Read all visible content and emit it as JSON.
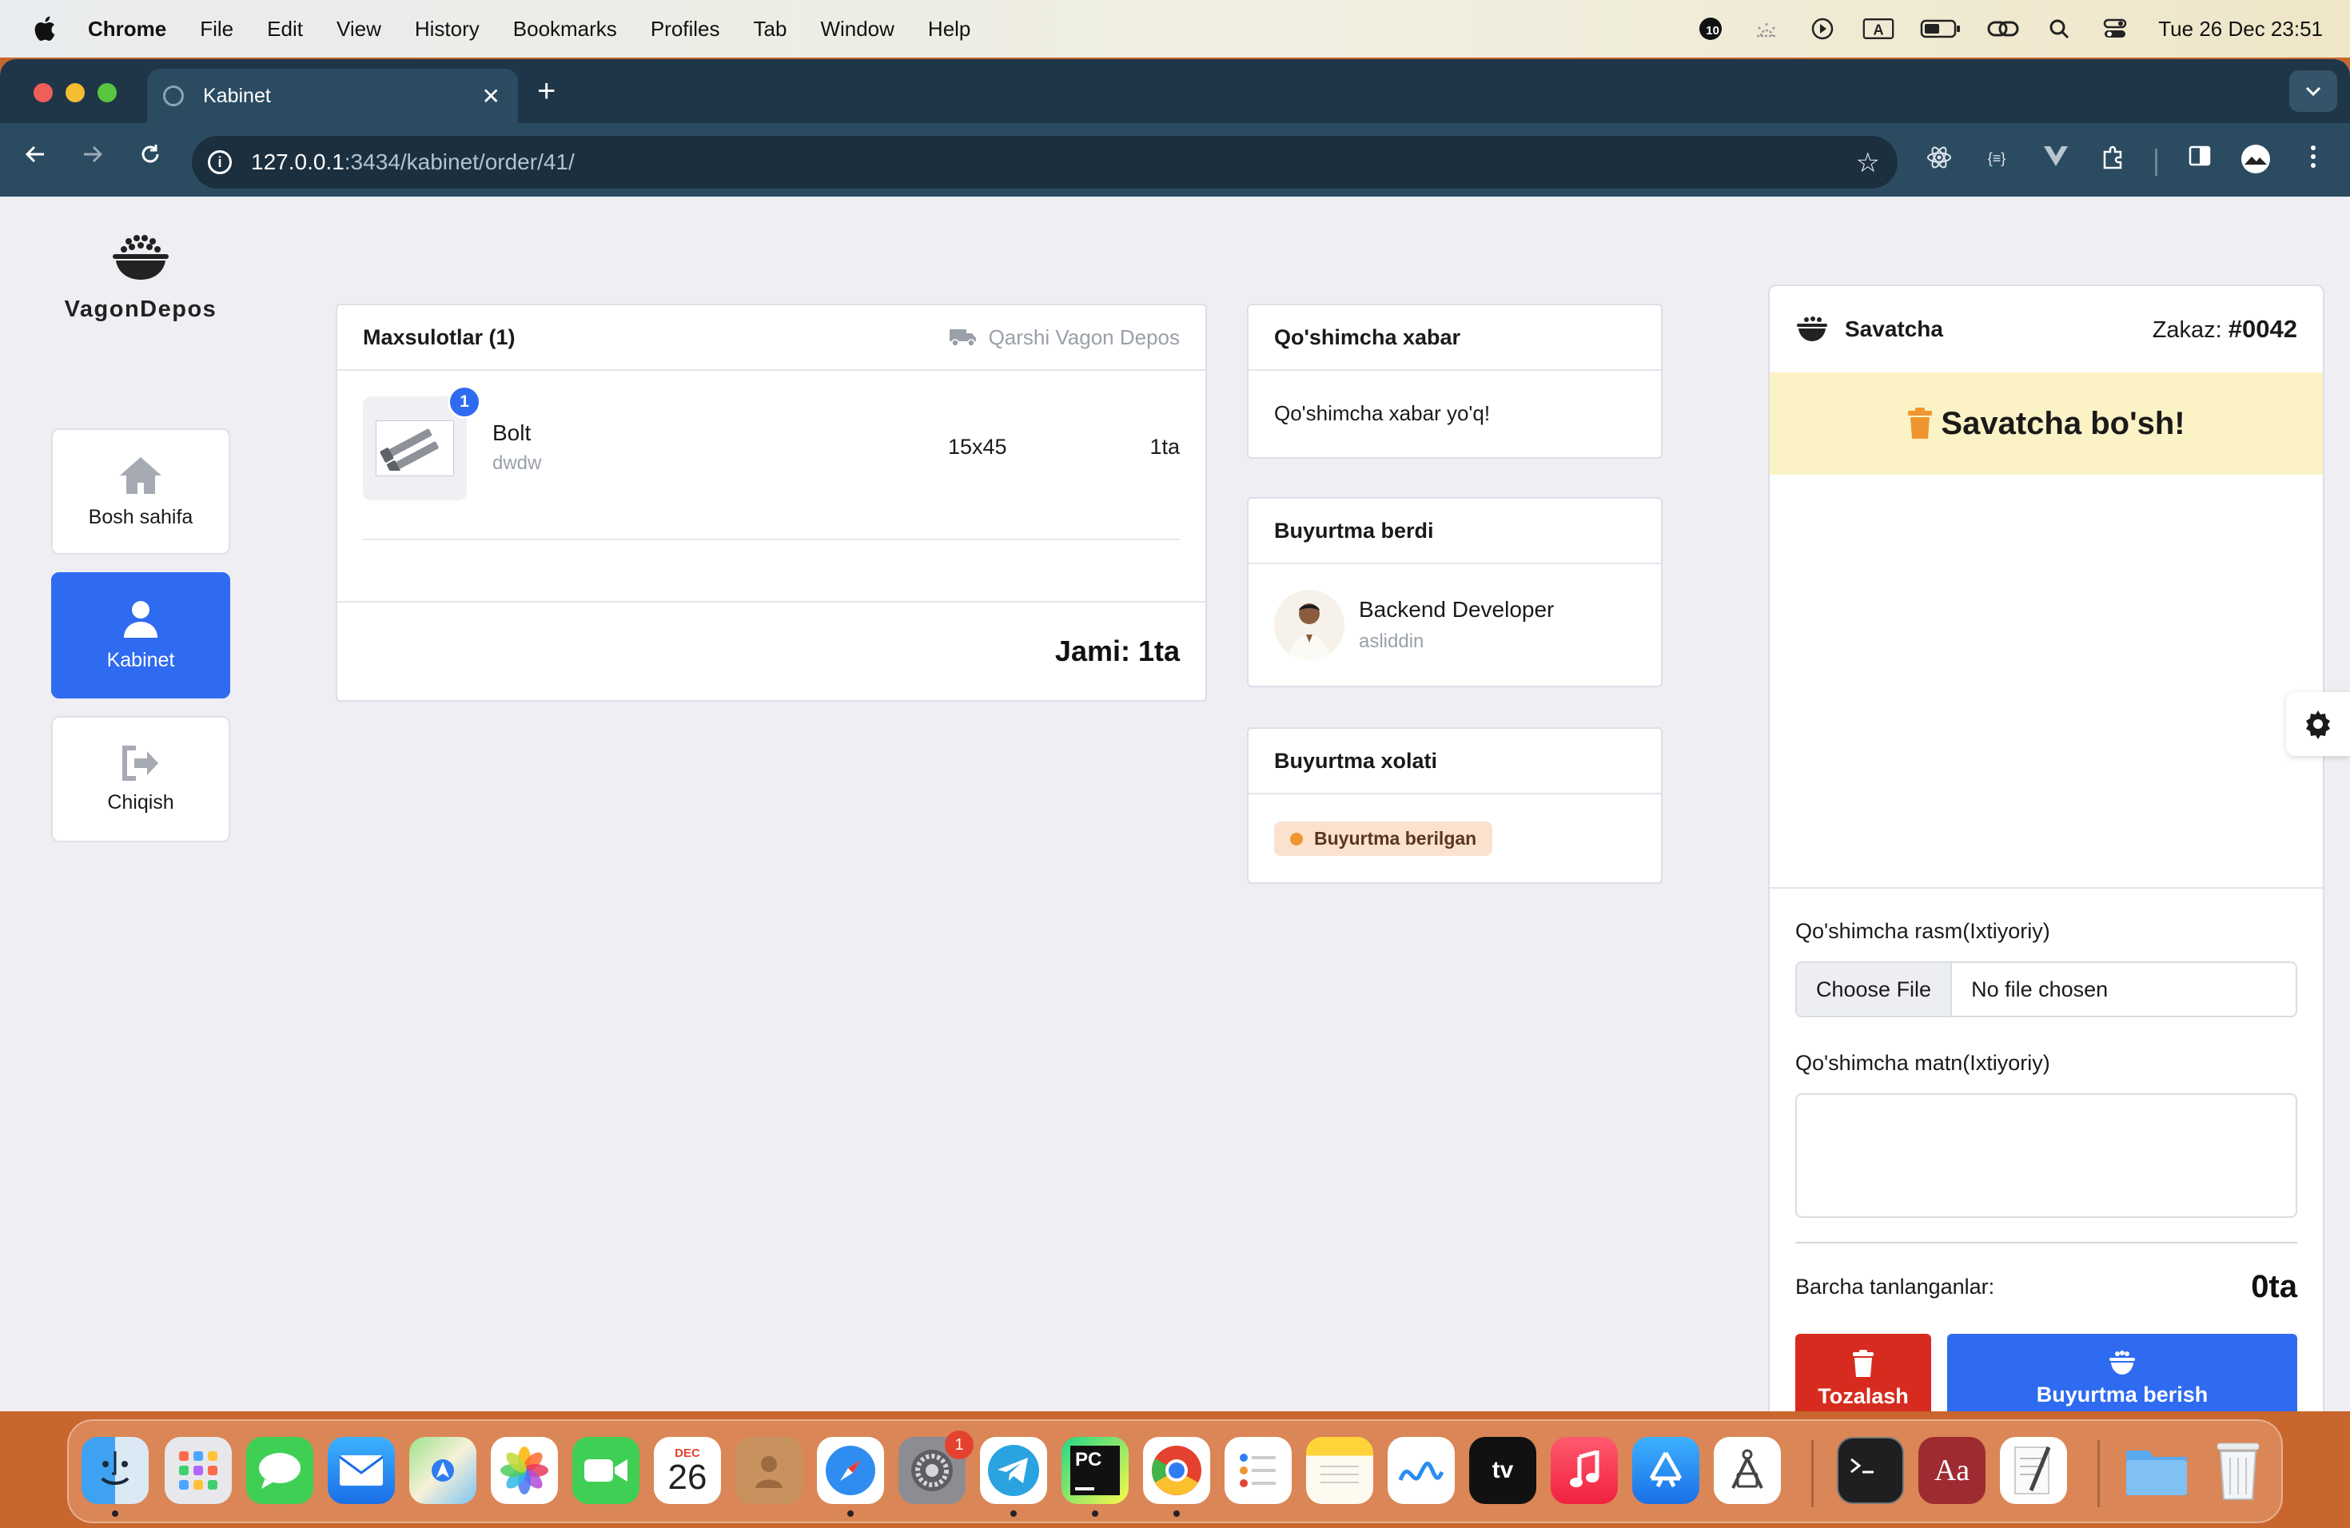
{
  "menubar": {
    "app": "Chrome",
    "items": [
      "File",
      "Edit",
      "View",
      "History",
      "Bookmarks",
      "Profiles",
      "Tab",
      "Window",
      "Help"
    ],
    "clock": "Tue 26 Dec  23:51",
    "notification_count": "10"
  },
  "browser": {
    "tab_title": "Kabinet",
    "url_host": "127.0.0.1",
    "url_rest": ":3434/kabinet/order/41/"
  },
  "sidebar": {
    "brand": "VagonDepos",
    "items": [
      {
        "label": "Bosh sahifa",
        "icon": "home-icon"
      },
      {
        "label": "Kabinet",
        "icon": "user-icon",
        "active": true
      },
      {
        "label": "Chiqish",
        "icon": "logout-icon"
      }
    ]
  },
  "products": {
    "title": "Maxsulotlar (1)",
    "depot": "Qarshi Vagon Depos",
    "items": [
      {
        "name": "Bolt",
        "sub": "dwdw",
        "size": "15x45",
        "qty": "1ta",
        "badge": "1"
      }
    ],
    "total": "Jami: 1ta"
  },
  "extra_message": {
    "title": "Qo'shimcha xabar",
    "text": "Qo'shimcha xabar yo'q!"
  },
  "ordered_by": {
    "title": "Buyurtma berdi",
    "name": "Backend Developer",
    "username": "asliddin"
  },
  "order_status": {
    "title": "Buyurtma xolati",
    "status": "Buyurtma berilgan",
    "status_color": "#f0962e"
  },
  "cart": {
    "title": "Savatcha",
    "order_label": "Zakaz:",
    "order_number": "#0042",
    "empty_text": "Savatcha bo'sh!",
    "image_label": "Qo'shimcha rasm(Ixtiyoriy)",
    "file_button": "Choose File",
    "file_status": "No file chosen",
    "text_label": "Qo'shimcha matn(Ixtiyoriy)",
    "text_value": "",
    "total_label": "Barcha tanlanganlar:",
    "total_value": "0ta",
    "clear_button": "Tozalash",
    "order_button": "Buyurtma berish"
  },
  "colors": {
    "accent": "#2f6bf0",
    "danger": "#d72b1f",
    "warning_bg": "#fbf3c6"
  },
  "dock": {
    "apps": [
      "Finder",
      "Launchpad",
      "Messages",
      "Mail",
      "Maps",
      "Photos",
      "FaceTime",
      "Calendar",
      "Contacts",
      "Safari",
      "System Settings",
      "Telegram",
      "PyCharm",
      "Chrome",
      "Reminders",
      "Notes",
      "Freeform",
      "TV",
      "Music",
      "App Store",
      "Screenshot",
      "Terminal",
      "Dictionary",
      "TextEdit",
      "Downloads",
      "Trash"
    ],
    "calendar_month": "DEC",
    "calendar_day": "26",
    "settings_badge": "1"
  }
}
